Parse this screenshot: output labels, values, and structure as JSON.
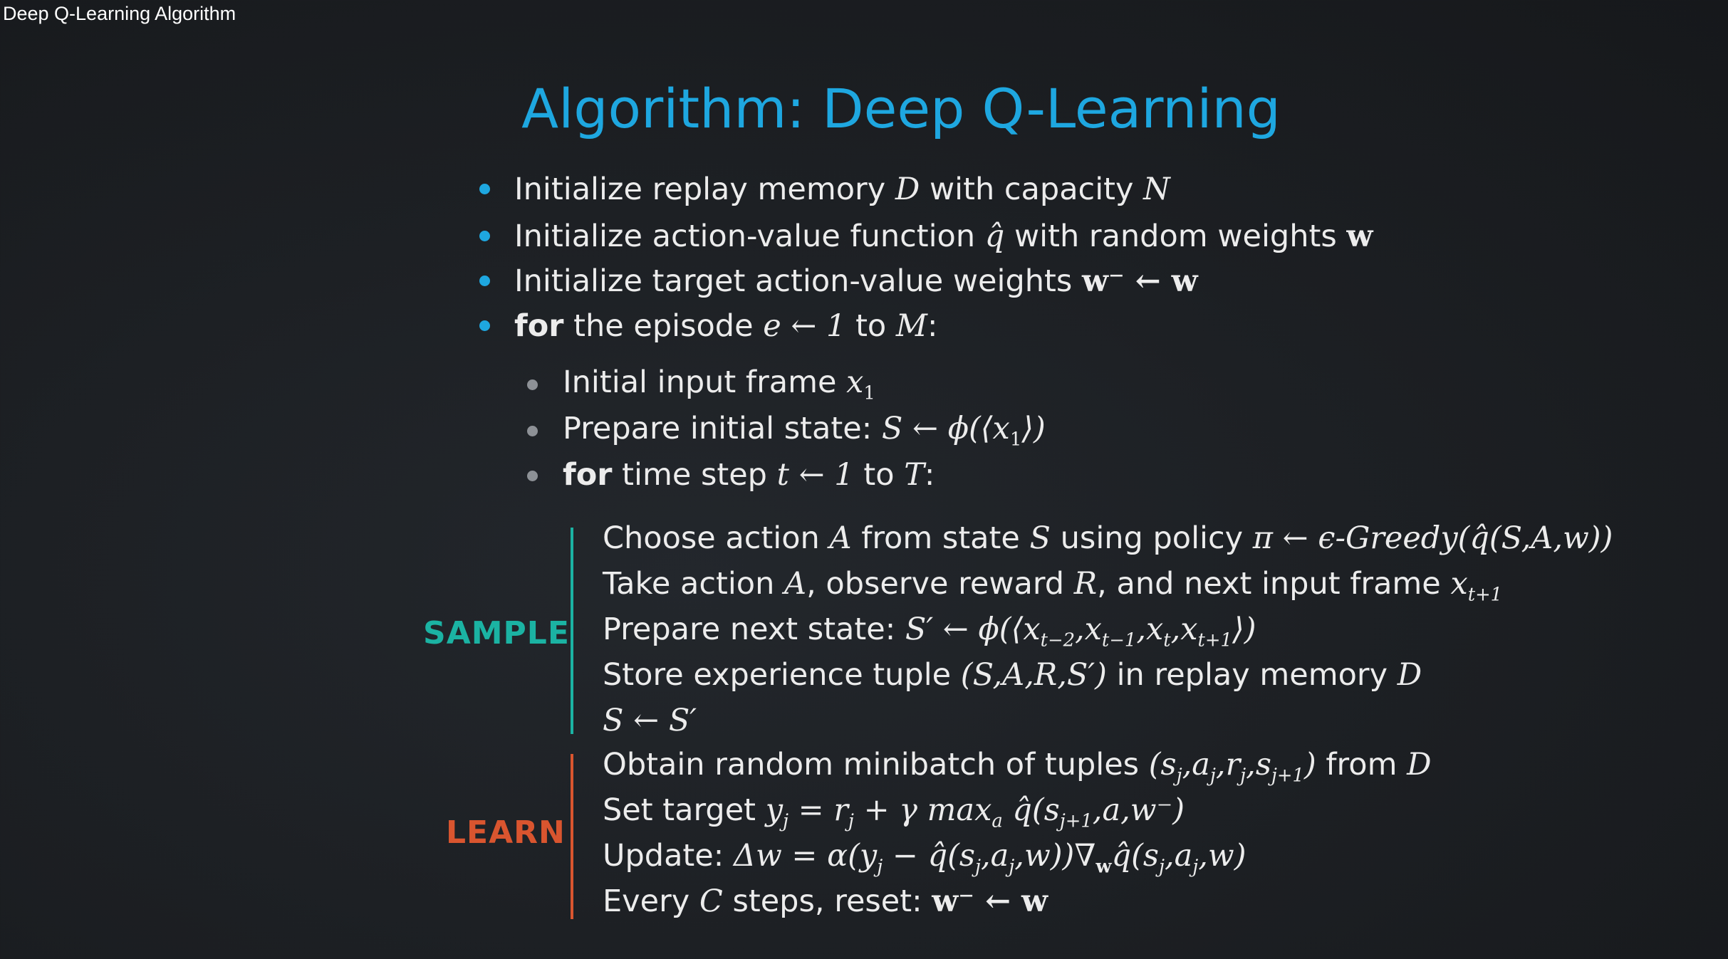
{
  "video": {
    "title": "Deep Q-Learning Algorithm"
  },
  "slide": {
    "title": "Algorithm: Deep Q-Learning",
    "accent_color": "#1ea7e0",
    "sample_color": "#1bb3a3",
    "learn_color": "#d9552f",
    "top_bullets": [
      {
        "text": "Initialize replay memory",
        "m1": "D",
        "t2": "with capacity",
        "m2": "N"
      },
      {
        "text": "Initialize action-value function",
        "m1": "q̂",
        "t2": "with random weights",
        "m2": "w"
      },
      {
        "text": "Initialize target action-value weights",
        "m1": "w⁻ ← w"
      },
      {
        "bold": "for",
        "text": "the episode",
        "m1": "e ← 1",
        "t2": "to",
        "m2": "M",
        "t3": ":"
      }
    ],
    "episode_bullets": [
      {
        "text": "Initial input frame",
        "m1": "x",
        "sub1": "1"
      },
      {
        "text": "Prepare initial state:",
        "m1": "S ← ϕ(⟨x",
        "sub1": "1",
        "m2": "⟩)"
      },
      {
        "bold": "for",
        "text": "time step",
        "m1": "t ← 1",
        "t2": "to",
        "m2": "T",
        "t3": ":"
      }
    ],
    "sample": {
      "label": "SAMPLE",
      "lines": [
        {
          "a": "Choose action",
          "b": "A",
          "c": "from state",
          "d": "S",
          "e": "using policy",
          "f": "π ← ϵ-Greedy(q̂(S,A,w))"
        },
        {
          "a": "Take action",
          "b": "A",
          "c": ", observe reward",
          "d": "R",
          "e": ", and next input frame",
          "f": "x",
          "g": "t+1"
        },
        {
          "a": "Prepare next state:",
          "f": "S′ ← ϕ(⟨x",
          "g1": "t−2",
          "h1": ",x",
          "g2": "t−1",
          "h2": ",x",
          "g3": "t",
          "h3": ",x",
          "g4": "t+1",
          "h4": "⟩)"
        },
        {
          "a": "Store experience tuple",
          "f": "(S,A,R,S′)",
          "c": "in replay memory",
          "d": "D"
        },
        {
          "f": "S ← S′"
        }
      ]
    },
    "learn": {
      "label": "LEARN",
      "lines": [
        {
          "a": "Obtain random minibatch of tuples",
          "f": "(s",
          "g1": "j",
          "h1": ",a",
          "g2": "j",
          "h2": ",r",
          "g3": "j",
          "h3": ",s",
          "g4": "j+1",
          "h4": ")",
          "c": "from",
          "d": "D"
        },
        {
          "a": "Set target",
          "f": "y",
          "g1": "j",
          "h1": " = r",
          "g2": "j",
          "h2": " + γ max",
          "g3": "a",
          "h3": " q̂(s",
          "g4": "j+1",
          "h4": ",a,w⁻)"
        },
        {
          "a": "Update:",
          "f": "Δw = α(y",
          "g1": "j",
          "h1": " − q̂(s",
          "g2": "j",
          "h2": ",a",
          "g3": "j",
          "h3": ",w))∇",
          "g4": "w",
          "h4": "q̂(s",
          "g5": "j",
          "h5": ",a",
          "g6": "j",
          "h6": ",w)"
        },
        {
          "a": "Every",
          "b": "C",
          "c": "steps, reset:",
          "f": "w⁻ ← w"
        }
      ]
    }
  }
}
